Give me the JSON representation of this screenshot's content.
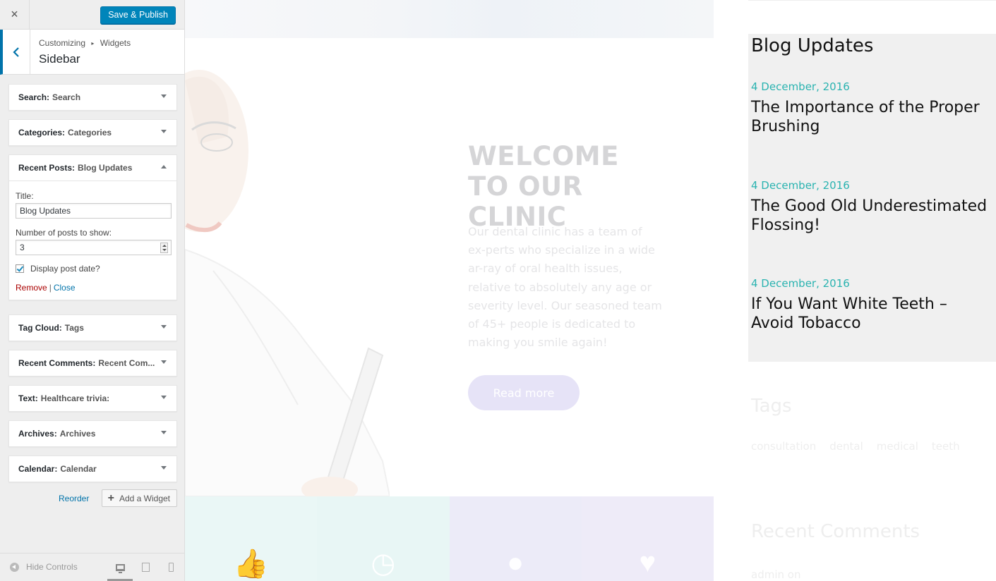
{
  "customizer": {
    "close_label": "×",
    "save_label": "Save & Publish",
    "breadcrumb": [
      "Customizing",
      "Widgets"
    ],
    "breadcrumb_separator": "▸",
    "section_title": "Sidebar",
    "widgets": [
      {
        "type": "Search",
        "title": "Search",
        "expanded": false
      },
      {
        "type": "Categories",
        "title": "Categories",
        "expanded": false
      },
      {
        "type": "Recent Posts",
        "title": "Blog Updates",
        "expanded": true
      },
      {
        "type": "Tag Cloud",
        "title": "Tags",
        "expanded": false
      },
      {
        "type": "Recent Comments",
        "title": "Recent Com...",
        "expanded": false
      },
      {
        "type": "Text",
        "title": "Healthcare trivia:",
        "expanded": false
      },
      {
        "type": "Archives",
        "title": "Archives",
        "expanded": false
      },
      {
        "type": "Calendar",
        "title": "Calendar",
        "expanded": false
      }
    ],
    "recent_posts_form": {
      "title_label": "Title:",
      "title_value": "Blog Updates",
      "number_label": "Number of posts to show:",
      "number_value": "3",
      "display_date_label": "Display post date?",
      "display_date_checked": true,
      "remove_label": "Remove",
      "separator": "|",
      "close_label": "Close"
    },
    "reorder_label": "Reorder",
    "add_widget_label": "Add a Widget",
    "hide_controls_label": "Hide Controls",
    "devices": [
      "desktop",
      "tablet",
      "mobile"
    ],
    "active_device": "desktop"
  },
  "preview": {
    "hero": {
      "heading": "WELCOME TO OUR CLINIC",
      "body": "Our dental clinic has a team of ex-perts who specialize in a wide ar-ray of oral health issues, relative to absolutely any age or severity level. Our seasoned team of 45+ people is dedicated to making you smile again!",
      "button_label": "Read more"
    },
    "features": [
      {
        "icon": "thumbs-up-icon",
        "glyph": "👍",
        "color": "#eaf7f6"
      },
      {
        "icon": "clock-icon",
        "glyph": "◷",
        "color": "#e8f6f5"
      },
      {
        "icon": "person-icon",
        "glyph": "●",
        "color": "#ecebf8"
      },
      {
        "icon": "heart-icon",
        "glyph": "♥",
        "color": "#eeebf8"
      }
    ],
    "sidebar": {
      "blog_title": "Blog Updates",
      "posts": [
        {
          "date": "4 December, 2016",
          "title": "The Importance of the Proper Brushing"
        },
        {
          "date": "4 December, 2016",
          "title": "The Good Old Underestimated Flossing!"
        },
        {
          "date": "4 December, 2016",
          "title": "If You Want White Teeth – Avoid Tobacco"
        }
      ],
      "tags_title": "Tags",
      "tags": [
        "consultation",
        "dental",
        "medical",
        "teeth"
      ],
      "recent_comments_title": "Recent Comments",
      "recent_comments_first": "admin on"
    }
  },
  "colors": {
    "accent": "#0073aa",
    "primary_button": "#0085ba",
    "date_teal": "#2ab3b0",
    "remove_red": "#aa0000"
  }
}
